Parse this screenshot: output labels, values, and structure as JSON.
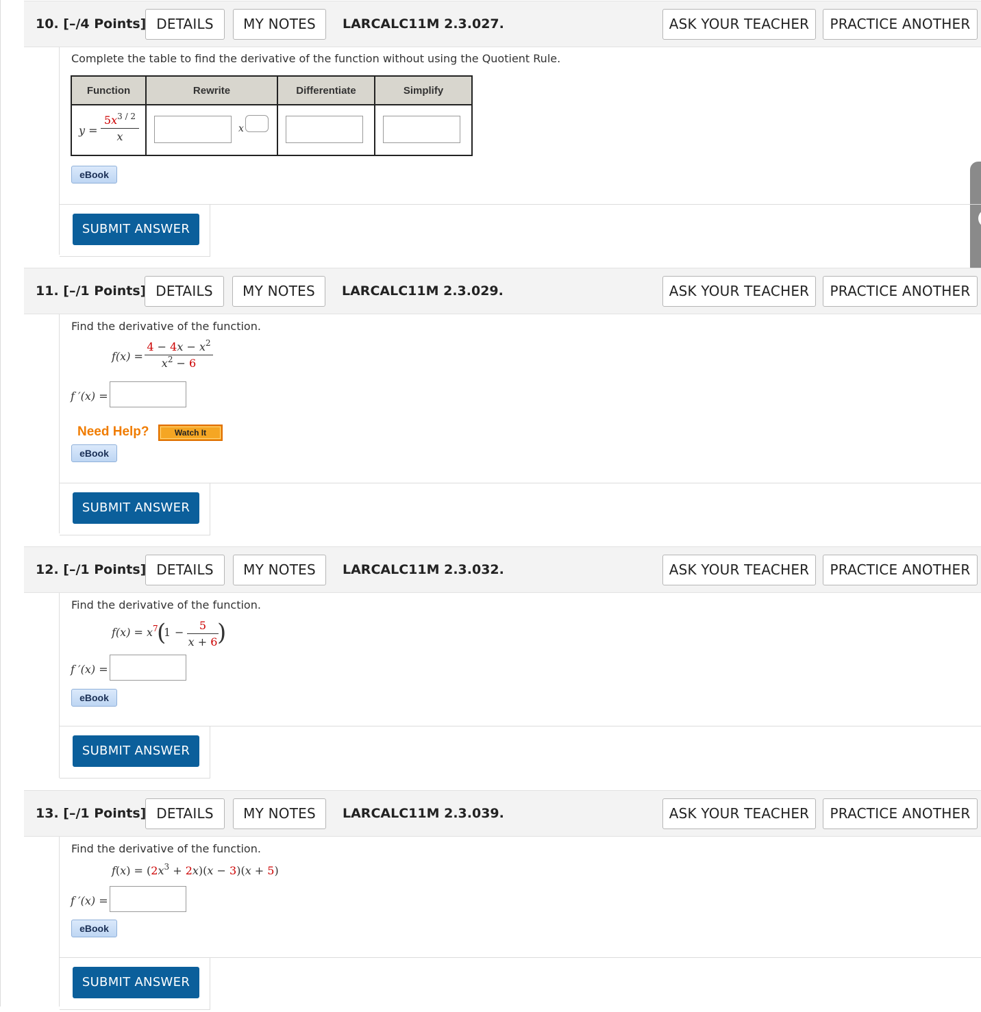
{
  "common": {
    "details_label": "DETAILS",
    "my_notes_label": "MY NOTES",
    "ask_teacher_label": "ASK YOUR TEACHER",
    "practice_another_label": "PRACTICE ANOTHER",
    "submit_label": "SUBMIT ANSWER",
    "ebook_label": "eBook",
    "fprime_label": "f ′(x)  ="
  },
  "q10": {
    "number": "10.",
    "points": "[–/4 Points]",
    "problem_id": "LARCALC11M 2.3.027.",
    "prompt": "Complete the table to find the derivative of the function without using the Quotient Rule.",
    "table_headers": [
      "Function",
      "Rewrite",
      "Differentiate",
      "Simplify"
    ],
    "function_lhs": "y =",
    "function_num_coef": "5",
    "function_num_var": "x",
    "function_num_exp": "3 / 2",
    "function_den": "x",
    "rewrite_var": "x"
  },
  "q11": {
    "number": "11.",
    "points": "[–/1 Points]",
    "problem_id": "LARCALC11M 2.3.029.",
    "prompt": "Find the derivative of the function.",
    "lhs": "f(x) =",
    "num_a": "4",
    "num_b": "4",
    "num_exp": "2",
    "den_exp": "2",
    "den_c": "6",
    "need_help": "Need Help?",
    "watch_it": "Watch It"
  },
  "q12": {
    "number": "12.",
    "points": "[–/1 Points]",
    "problem_id": "LARCALC11M 2.3.032.",
    "prompt": "Find the derivative of the function.",
    "lhs": "f(x) = x",
    "exp": "7",
    "one": "1",
    "frac_num": "5",
    "frac_den_c": "6"
  },
  "q13": {
    "number": "13.",
    "points": "[–/1 Points]",
    "problem_id": "LARCALC11M 2.3.039.",
    "prompt": "Find the derivative of the function.",
    "c1": "2",
    "e1": "3",
    "c2": "2",
    "c3": "3",
    "c4": "5"
  }
}
